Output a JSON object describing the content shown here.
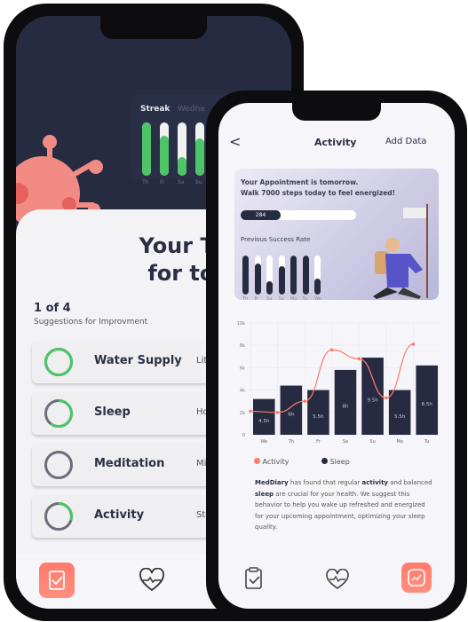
{
  "back_phone": {
    "streak": {
      "title": "Streak",
      "subtitle": "Wedne",
      "days": [
        {
          "label": "Th",
          "fill": 1.0
        },
        {
          "label": "Fr",
          "fill": 0.75
        },
        {
          "label": "Sa",
          "fill": 0.35
        },
        {
          "label": "Su",
          "fill": 0.7
        }
      ]
    },
    "heading_line1": "Your Tasks",
    "heading_line2": "for today",
    "progress": "1 of 4",
    "progress_sub": "Suggestions for Improvment",
    "tasks": [
      {
        "name": "Water Supply",
        "unit": "Lite",
        "icon": "water-bottle-icon",
        "progress": 1.0
      },
      {
        "name": "Sleep",
        "unit": "Ho",
        "icon": "sleep-moon-icon",
        "progress": 0.6
      },
      {
        "name": "Meditation",
        "unit": "Min",
        "icon": "meditation-icon",
        "progress": 0
      },
      {
        "name": "Activity",
        "unit": "Ste",
        "icon": "walking-icon",
        "progress": 0.3
      }
    ],
    "nav": [
      "clipboard-check-icon",
      "heart-pulse-icon"
    ]
  },
  "front_phone": {
    "header": {
      "back": "<",
      "title": "Activity",
      "action": "Add Data"
    },
    "card": {
      "line1": "Your Appointment is tomorrow.",
      "line2": "Walk 7000 steps today to feel energized!",
      "steps": "284",
      "steps_progress": 0.04,
      "success_title": "Previous Success Rate",
      "days": [
        {
          "label": "Th",
          "fill": 1.0
        },
        {
          "label": "Fr",
          "fill": 0.8
        },
        {
          "label": "Sa",
          "fill": 0.35
        },
        {
          "label": "Su",
          "fill": 0.72
        },
        {
          "label": "Mo",
          "fill": 1.0
        },
        {
          "label": "Tu",
          "fill": 1.0
        },
        {
          "label": "We",
          "fill": 0.42
        }
      ]
    },
    "description": {
      "brand": "MedDiary",
      "t1": " has found that regular ",
      "w1": "activity",
      "t2": " and balanced ",
      "w2": "sleep",
      "t3": " are crucial for your health. We suggest this behavior to help you wake up refreshed and energized for your upcoming appointment, optimizing your sleep quality."
    },
    "nav": [
      "clipboard-check-icon",
      "heart-pulse-icon",
      "activity-chart-icon"
    ]
  },
  "colors": {
    "accent": "#ff7a6b",
    "navy": "#262b42",
    "green": "#4cc467"
  },
  "chart_data": {
    "type": "bar+line",
    "categories": [
      "We",
      "Th",
      "Fr",
      "Sa",
      "Su",
      "Mo",
      "Tu"
    ],
    "yticks": [
      "0",
      "2k",
      "4k",
      "6k",
      "8k",
      "10k"
    ],
    "ylim": [
      0,
      10000
    ],
    "series": [
      {
        "name": "Sleep",
        "type": "bar",
        "values": [
          3200,
          4400,
          4000,
          5800,
          6900,
          4000,
          6200
        ],
        "labels": [
          "4.5h",
          "6h",
          "5.5h",
          "8h",
          "9.5h",
          "5.5h",
          "8.5h"
        ],
        "color": "#262b42"
      },
      {
        "name": "Activity",
        "type": "line",
        "values": [
          2100,
          2000,
          3000,
          7600,
          6800,
          3300,
          8100
        ],
        "color": "#ff7a6b"
      }
    ],
    "grid": true,
    "legend": "bottom"
  }
}
